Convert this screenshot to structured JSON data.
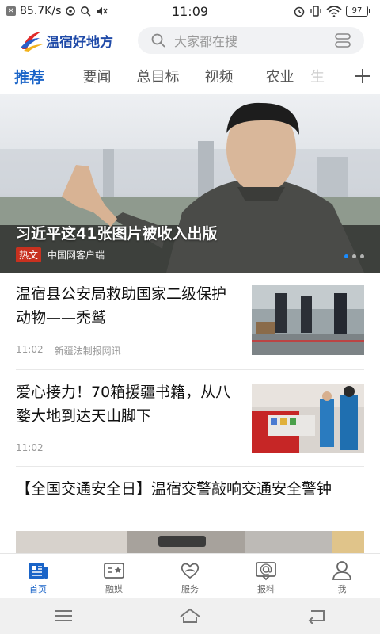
{
  "status_bar": {
    "net_speed": "85.7K/s",
    "time": "11:09",
    "battery": "97"
  },
  "header": {
    "app_name": "温宿好地方",
    "search_placeholder": "大家都在搜"
  },
  "tabs": [
    {
      "label": "推荐",
      "active": true
    },
    {
      "label": "要闻",
      "active": false
    },
    {
      "label": "总目标",
      "active": false
    },
    {
      "label": "视频",
      "active": false
    },
    {
      "label": "农业",
      "active": false
    },
    {
      "label": "生",
      "active": false
    }
  ],
  "banner": {
    "title": "习近平这41张图片被收入出版",
    "tag": "热文",
    "source": "中国网客户端"
  },
  "news": [
    {
      "title": "温宿县公安局救助国家二级保护动物——秃鹫",
      "time": "11:02",
      "source": "新疆法制报网讯"
    },
    {
      "title": "爱心接力！70箱援疆书籍，从八婺大地到达天山脚下",
      "time": "11:02",
      "source": ""
    },
    {
      "title": "【全国交通安全日】温宿交警敲响交通安全警钟",
      "time": "",
      "source": ""
    }
  ],
  "bottom_nav": [
    {
      "label": "首页",
      "icon": "news-icon",
      "active": true
    },
    {
      "label": "融媒",
      "icon": "media-icon",
      "active": false
    },
    {
      "label": "服务",
      "icon": "heart-hands-icon",
      "active": false
    },
    {
      "label": "报料",
      "icon": "report-icon",
      "active": false
    },
    {
      "label": "我",
      "icon": "person-icon",
      "active": false
    }
  ],
  "colors": {
    "accent": "#1a64c8",
    "hot_tag": "#c8311f"
  }
}
